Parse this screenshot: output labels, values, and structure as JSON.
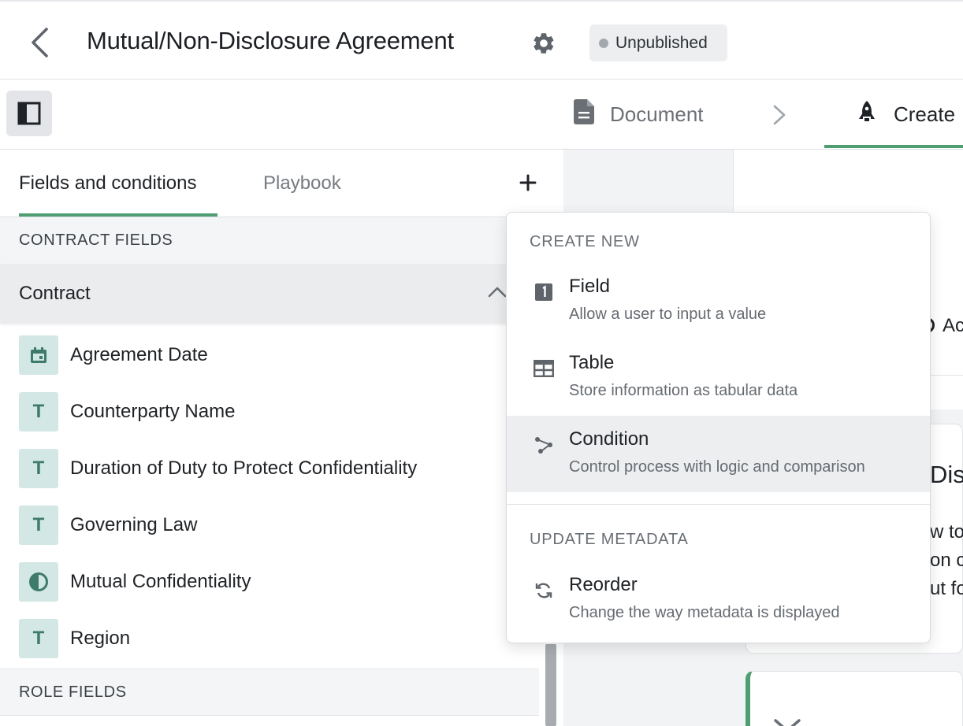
{
  "header": {
    "title": "Mutual/Non-Disclosure Agreement",
    "status": "Unpublished",
    "status_color": "#a3a8ae"
  },
  "steps": {
    "document": "Document",
    "create": "Create"
  },
  "left_panel": {
    "tabs": [
      {
        "label": "Fields and conditions",
        "active": true
      },
      {
        "label": "Playbook",
        "active": false
      }
    ],
    "contract_fields_heading": "CONTRACT FIELDS",
    "group": "Contract",
    "fields": [
      {
        "label": "Agreement Date",
        "icon": "calendar-icon"
      },
      {
        "label": "Counterparty Name",
        "icon": "text-type-icon"
      },
      {
        "label": "Duration of Duty to Protect Confidentiality",
        "icon": "text-type-icon"
      },
      {
        "label": "Governing Law",
        "icon": "text-type-icon"
      },
      {
        "label": "Mutual Confidentiality",
        "icon": "half-circle-icon"
      },
      {
        "label": "Region",
        "icon": "text-type-icon"
      }
    ],
    "role_fields_heading": "ROLE FIELDS"
  },
  "menu": {
    "create_heading": "CREATE NEW",
    "items": [
      {
        "title": "Field",
        "description": "Allow a user to input a value",
        "icon": "numbered-field-icon"
      },
      {
        "title": "Table",
        "description": "Store information as tabular data",
        "icon": "table-icon"
      },
      {
        "title": "Condition",
        "description": "Control process with logic and comparison",
        "icon": "condition-icon",
        "hovered": true
      }
    ],
    "update_heading": "UPDATE METADATA",
    "update_items": [
      {
        "title": "Reorder",
        "description": "Change the way metadata is displayed",
        "icon": "reorder-icon"
      }
    ]
  },
  "preview": {
    "peek_1": "Ac",
    "peek_heading": "Dis",
    "peek_line_1": "w to",
    "peek_line_2": "on c",
    "peek_line_3": "ut fo"
  },
  "colors": {
    "accent": "#4f9e72",
    "field_icon_bg": "#d3e7e4",
    "field_icon_fg": "#3e7b6a"
  }
}
